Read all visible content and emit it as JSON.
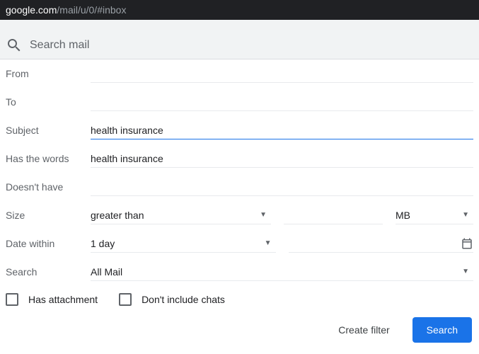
{
  "url": {
    "host": "google.com",
    "path": "/mail/u/0/#inbox"
  },
  "search": {
    "placeholder": "Search mail"
  },
  "form": {
    "from": {
      "label": "From",
      "value": ""
    },
    "to": {
      "label": "To",
      "value": ""
    },
    "subject": {
      "label": "Subject",
      "value": "health insurance"
    },
    "has_words": {
      "label": "Has the words",
      "value": "health insurance"
    },
    "doesnt_have": {
      "label": "Doesn't have",
      "value": ""
    },
    "size": {
      "label": "Size",
      "comparator": "greater than",
      "value": "",
      "unit": "MB"
    },
    "date_within": {
      "label": "Date within",
      "value": "1 day"
    },
    "search_scope": {
      "label": "Search",
      "value": "All Mail"
    },
    "has_attachment": {
      "label": "Has attachment",
      "checked": false
    },
    "dont_include_chats": {
      "label": "Don't include chats",
      "checked": false
    }
  },
  "buttons": {
    "create_filter": "Create filter",
    "search": "Search"
  }
}
